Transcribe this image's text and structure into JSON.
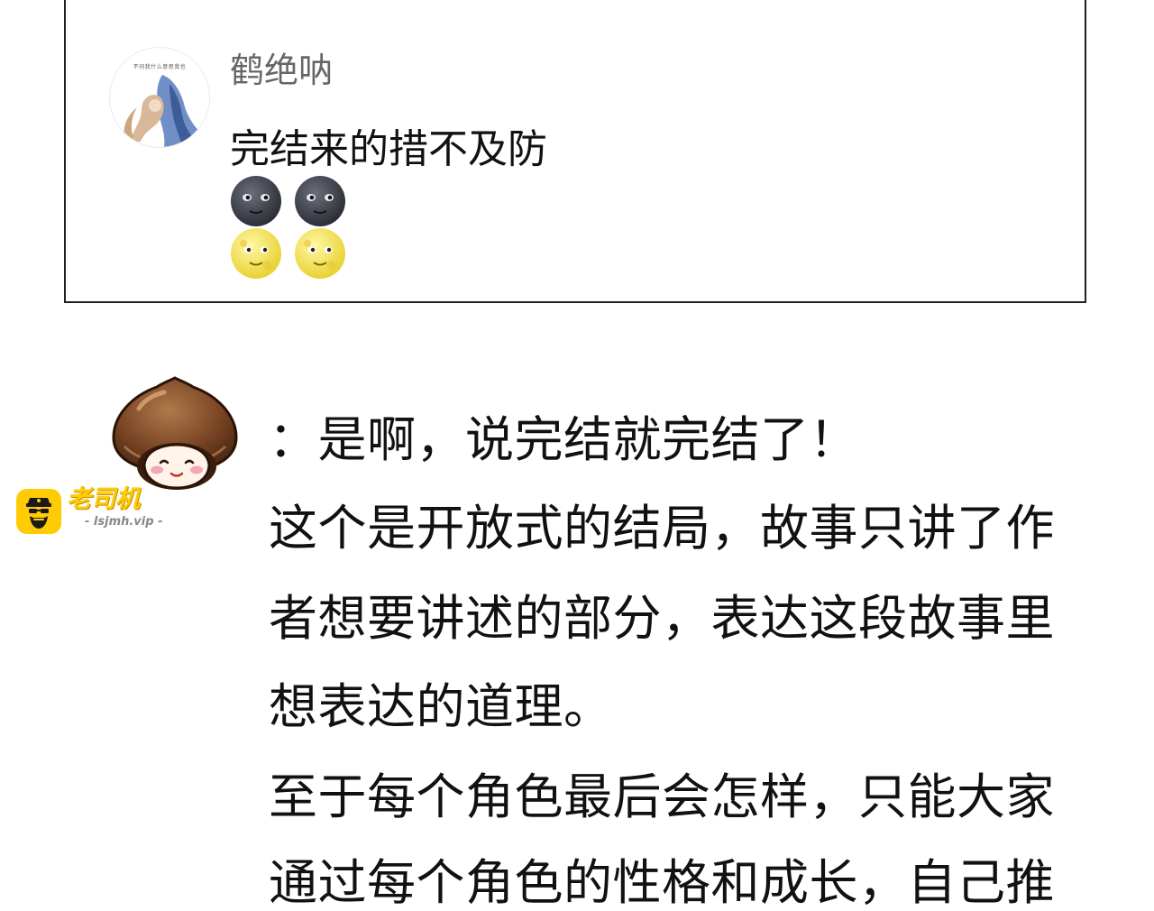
{
  "comment": {
    "username": "鹤绝呐",
    "avatar_caption": "不问我什么意思我也",
    "text": "完结来的措不及防",
    "emoji_rows": [
      [
        "new-moon-face-emoji",
        "new-moon-face-emoji"
      ],
      [
        "full-moon-face-emoji",
        "full-moon-face-emoji"
      ]
    ]
  },
  "watermark": {
    "title": "老司机",
    "url": "- lsjmh.vip -",
    "color": "#ffcb05"
  },
  "reply": {
    "first_line": "：是啊，说完结就完结了！",
    "lines": [
      "这个是开放式的结局，故事只讲了作",
      "者想要讲述的部分，表达这段故事里",
      "想表达的道理。",
      "至于每个角色最后会怎样，只能大家",
      "通过每个角色的性格和成长，自己推"
    ]
  }
}
